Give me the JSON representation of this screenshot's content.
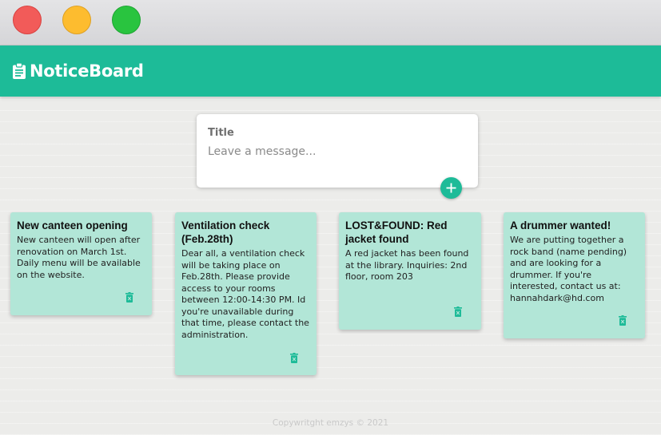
{
  "window": {
    "controls": [
      "close",
      "minimize",
      "maximize"
    ]
  },
  "header": {
    "brand": "NoticeBoard",
    "brand_icon": "clipboard-icon",
    "color": "#1dbb98"
  },
  "composer": {
    "title_placeholder": "Title",
    "message_placeholder": "Leave a message...",
    "add_icon": "plus-icon"
  },
  "notes": [
    {
      "title": "New canteen opening",
      "body": "New canteen will open after renovation on March 1st. Daily menu will be available on the website.",
      "delete_icon": "trash-icon"
    },
    {
      "title": "Ventilation check (Feb.28th)",
      "body": "Dear all, a ventilation check will be taking place on Feb.28th. Please provide access to your rooms between 12:00-14:30 PM. Id you're unavailable during that time, please contact the administration.",
      "delete_icon": "trash-icon"
    },
    {
      "title": "LOST&FOUND: Red jacket found",
      "body": "A red jacket has been found at the library. Inquiries: 2nd floor, room 203",
      "delete_icon": "trash-icon"
    },
    {
      "title": "A drummer wanted!",
      "body": "We are putting together a rock band (name pending) and are looking for a drummer. If you're interested, contact us at: hannahdark@hd.com",
      "delete_icon": "trash-icon"
    }
  ],
  "footer": {
    "text": "Copywritght emzys © 2021"
  }
}
